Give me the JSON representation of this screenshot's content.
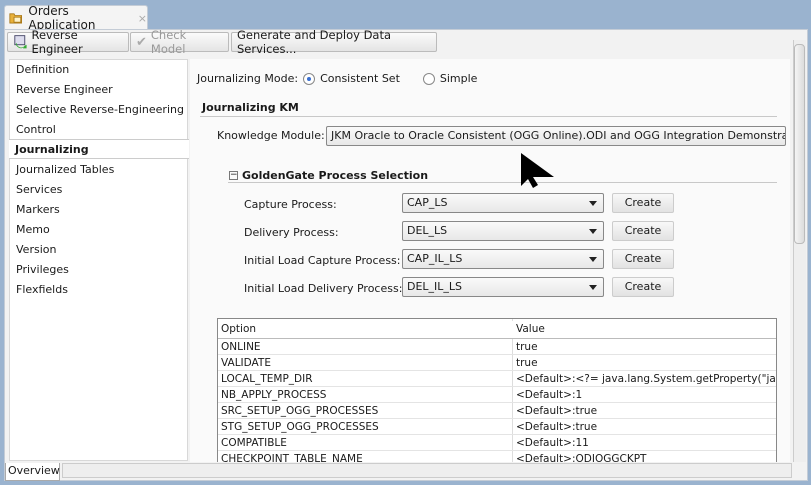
{
  "tab": {
    "title": "Orders Application",
    "close": "×"
  },
  "toolbar": {
    "reverse_engineer": "Reverse Engineer",
    "check_model": "Check Model",
    "generate_deploy": "Generate and Deploy Data Services..."
  },
  "nav": {
    "items": [
      "Definition",
      "Reverse Engineer",
      "Selective Reverse-Engineering",
      "Control",
      "Journalizing",
      "Journalized Tables",
      "Services",
      "Markers",
      "Memo",
      "Version",
      "Privileges",
      "Flexfields"
    ],
    "selected": "Journalizing"
  },
  "journalizing": {
    "mode_label": "Journalizing Mode:",
    "mode_options": [
      "Consistent Set",
      "Simple"
    ],
    "mode_selected": "Consistent Set",
    "km_section": "Journalizing KM",
    "km_label": "Knowledge Module:",
    "km_value": "JKM Oracle to Oracle Consistent (OGG Online).ODI and OGG Integration Demonstration",
    "gg_section": "GoldenGate Process Selection",
    "processes": [
      {
        "label": "Capture Process:",
        "value": "CAP_LS",
        "button": "Create"
      },
      {
        "label": "Delivery Process:",
        "value": "DEL_LS",
        "button": "Create"
      },
      {
        "label": "Initial Load Capture Process:",
        "value": "CAP_IL_LS",
        "button": "Create"
      },
      {
        "label": "Initial Load Delivery Process:",
        "value": "DEL_IL_LS",
        "button": "Create"
      }
    ],
    "options_table": {
      "headers": [
        "Option",
        "Value"
      ],
      "rows": [
        [
          "ONLINE",
          "true"
        ],
        [
          "VALIDATE",
          "true"
        ],
        [
          "LOCAL_TEMP_DIR",
          "<Default>:<?= java.lang.System.getProperty(\"java.io.tmpdir\") ?>"
        ],
        [
          "NB_APPLY_PROCESS",
          "<Default>:1"
        ],
        [
          "SRC_SETUP_OGG_PROCESSES",
          "<Default>:true"
        ],
        [
          "STG_SETUP_OGG_PROCESSES",
          "<Default>:true"
        ],
        [
          "COMPATIBLE",
          "<Default>:11"
        ],
        [
          "CHECKPOINT_TABLE_NAME",
          "<Default>:ODIOGGCKPT"
        ]
      ]
    }
  },
  "bottom_tab": "Overview"
}
